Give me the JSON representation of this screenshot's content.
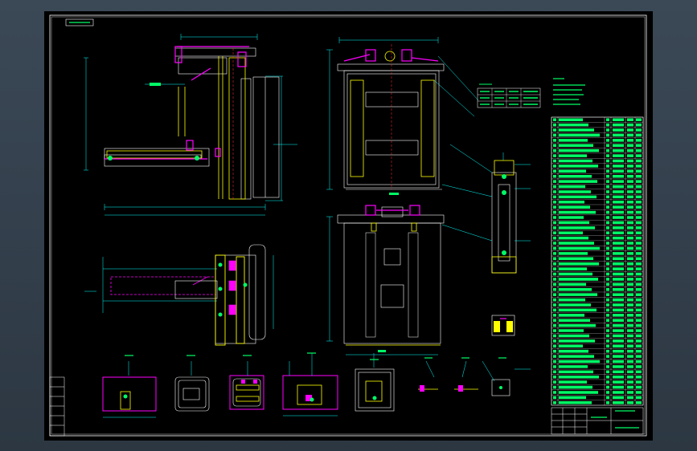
{
  "colors": {
    "background": "#000000",
    "frame": "#ffffff",
    "dimension": "#00ffff",
    "part_outline": "#ffffff",
    "highlight": "#ff00ff",
    "yellow": "#ffff00",
    "green": "#00ff66",
    "red": "#ff3030"
  },
  "bom_rows": 56,
  "summary_rows": 5
}
